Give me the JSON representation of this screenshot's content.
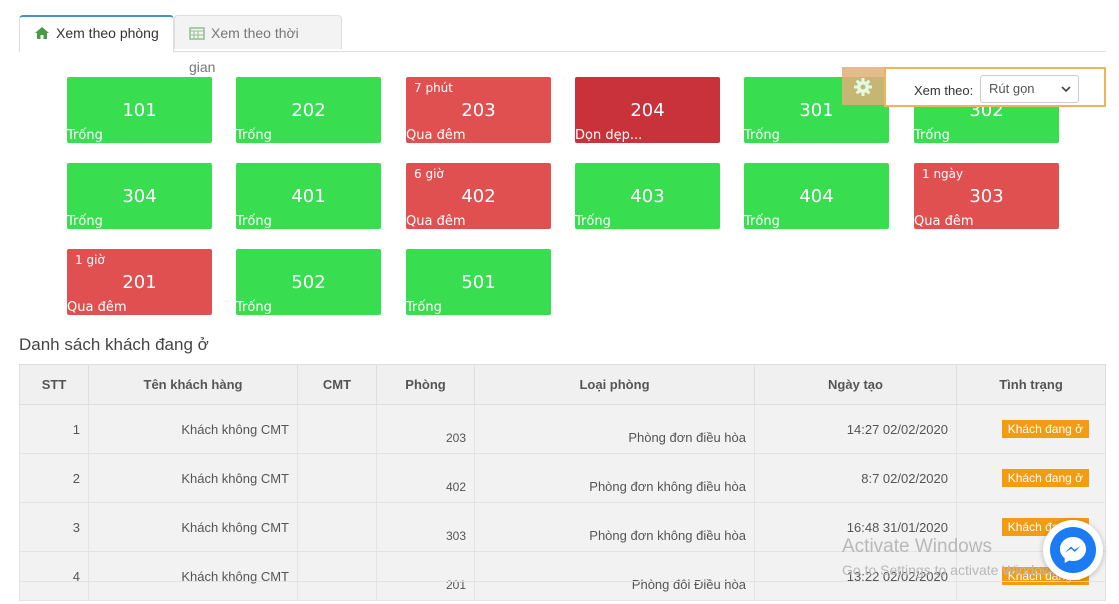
{
  "tabs": [
    {
      "label": "Xem theo phòng",
      "icon": "home-icon",
      "active": true
    },
    {
      "label": "Xem theo thời gian",
      "icon": "calendar-icon",
      "active": false
    }
  ],
  "view_settings": {
    "label": "Xem theo:",
    "selected": "Rút gọn",
    "icon": "gear-icon"
  },
  "rooms": [
    {
      "number": "101",
      "status": "Trống",
      "time": "",
      "color": "green"
    },
    {
      "number": "202",
      "status": "Trống",
      "time": "",
      "color": "green"
    },
    {
      "number": "203",
      "status": "Qua đêm",
      "time": "7 phút",
      "color": "red"
    },
    {
      "number": "204",
      "status": "Dọn dẹp...",
      "time": "",
      "color": "darkred"
    },
    {
      "number": "301",
      "status": "Trống",
      "time": "",
      "color": "green"
    },
    {
      "number": "302",
      "status": "Trống",
      "time": "",
      "color": "green"
    },
    {
      "number": "304",
      "status": "Trống",
      "time": "",
      "color": "green"
    },
    {
      "number": "401",
      "status": "Trống",
      "time": "",
      "color": "green"
    },
    {
      "number": "402",
      "status": "Qua đêm",
      "time": "6 giờ",
      "color": "red"
    },
    {
      "number": "403",
      "status": "Trống",
      "time": "",
      "color": "green"
    },
    {
      "number": "404",
      "status": "Trống",
      "time": "",
      "color": "green"
    },
    {
      "number": "303",
      "status": "Qua đêm",
      "time": "1 ngày",
      "color": "red"
    },
    {
      "number": "201",
      "status": "Qua đêm",
      "time": "1 giờ",
      "color": "red"
    },
    {
      "number": "502",
      "status": "Trống",
      "time": "",
      "color": "green"
    },
    {
      "number": "501",
      "status": "Trống",
      "time": "",
      "color": "green"
    }
  ],
  "colors": {
    "green": "#38dd50",
    "red": "#e15050",
    "darkred": "#c9323a",
    "badge": "#f39c12"
  },
  "guest_list": {
    "title": "Danh sách khách đang ở",
    "columns": [
      "STT",
      "Tên khách hàng",
      "CMT",
      "Phòng",
      "Loại phòng",
      "Ngày tạo",
      "Tình trạng"
    ],
    "rows": [
      {
        "stt": "1",
        "name": "Khách không CMT",
        "cmt": "",
        "room": "203",
        "type": "Phòng đơn điều hòa",
        "created": "14:27 02/02/2020",
        "status": "Khách đang ở"
      },
      {
        "stt": "2",
        "name": "Khách không CMT",
        "cmt": "",
        "room": "402",
        "type": "Phòng đơn không điều hòa",
        "created": "8:7 02/02/2020",
        "status": "Khách đang ở"
      },
      {
        "stt": "3",
        "name": "Khách không CMT",
        "cmt": "",
        "room": "303",
        "type": "Phòng đơn không điều hòa",
        "created": "16:48 31/01/2020",
        "status": "Khách đang ở"
      },
      {
        "stt": "4",
        "name": "Khách không CMT",
        "cmt": "",
        "room": "201",
        "type": "Phòng đôi Điều hòa",
        "created": "13:22 02/02/2020",
        "status": "Khách đang ở"
      }
    ]
  },
  "watermark": {
    "line1": "Activate Windows",
    "line2": "Go to Settings to activate Windows."
  },
  "messenger": {
    "icon": "messenger-icon"
  }
}
